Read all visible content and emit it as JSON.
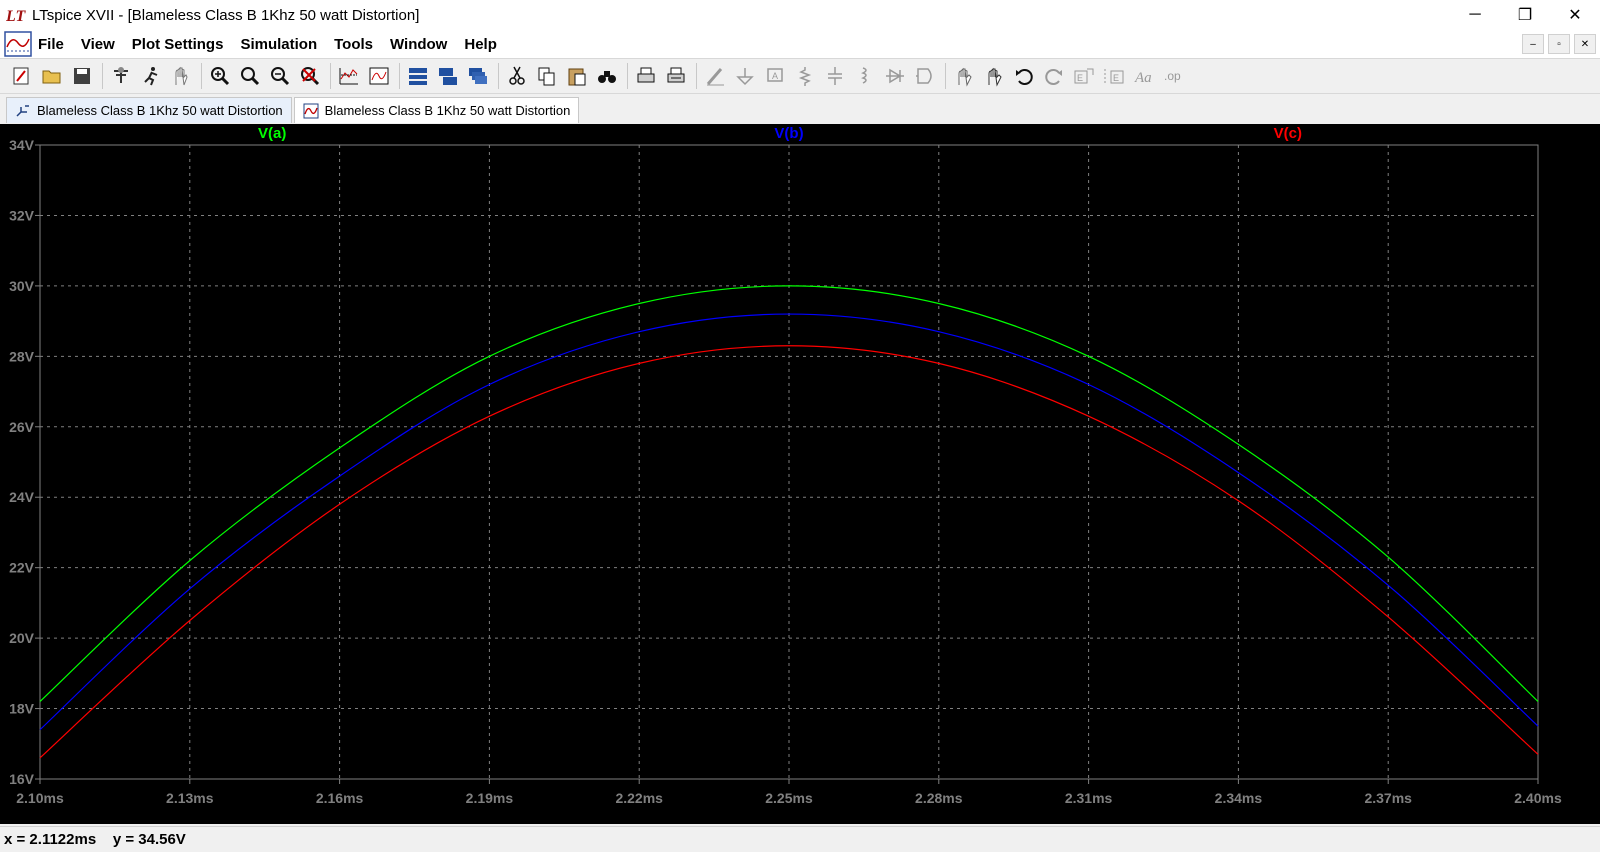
{
  "window": {
    "title": "LTspice XVII - [Blameless Class B 1Khz 50 watt Distortion]",
    "minimize_glyph": "─",
    "maximize_glyph": "❐",
    "close_glyph": "✕"
  },
  "menu": {
    "items": [
      "File",
      "View",
      "Plot Settings",
      "Simulation",
      "Tools",
      "Window",
      "Help"
    ],
    "mdi": [
      "–",
      "▫",
      "✕"
    ]
  },
  "toolbar": {
    "buttons": [
      "new-schematic-icon",
      "open-icon",
      "save-icon",
      "control-panel-icon",
      "run-icon",
      "halt-icon",
      "zoom-in-icon",
      "zoom-area-icon",
      "zoom-out-icon",
      "zoom-cancel-icon",
      "autorange-icon",
      "waveform-icon",
      "tile-horizontal-icon",
      "tile-vertical-icon",
      "cascade-icon",
      "cut-icon",
      "copy-icon",
      "paste-icon",
      "find-icon",
      "print-icon",
      "print-setup-icon",
      "draw-wire-icon",
      "ground-icon",
      "label-net-icon",
      "resistor-icon",
      "capacitor-icon",
      "inductor-icon",
      "diode-icon",
      "component-icon",
      "move-icon",
      "drag-icon",
      "undo-icon",
      "redo-icon",
      "rotate-icon",
      "mirror-icon",
      "text-icon",
      "spice-directive-icon"
    ]
  },
  "tabs": [
    {
      "label": "Blameless Class B 1Khz 50 watt Distortion",
      "icon": "schematic-icon"
    },
    {
      "label": "Blameless Class B 1Khz 50 watt Distortion",
      "icon": "waveform-icon"
    }
  ],
  "status": {
    "cursor_readout": "x = 2.1122ms    y = 34.56V"
  },
  "chart_data": {
    "type": "line",
    "title": "",
    "xlabel": "",
    "ylabel": "",
    "xlim": [
      2.1,
      2.4
    ],
    "ylim": [
      16,
      34
    ],
    "x_ticks": [
      "2.10ms",
      "2.13ms",
      "2.16ms",
      "2.19ms",
      "2.22ms",
      "2.25ms",
      "2.28ms",
      "2.31ms",
      "2.34ms",
      "2.37ms",
      "2.40ms"
    ],
    "y_ticks": [
      "16V",
      "18V",
      "20V",
      "22V",
      "24V",
      "26V",
      "28V",
      "30V",
      "32V",
      "34V"
    ],
    "grid": true,
    "background": "#000000",
    "series": [
      {
        "name": "V(a)",
        "color": "#00ff00",
        "x": [
          2.1,
          2.13,
          2.16,
          2.19,
          2.22,
          2.25,
          2.28,
          2.31,
          2.34,
          2.37,
          2.4
        ],
        "values": [
          18.2,
          22.2,
          25.4,
          28.0,
          29.5,
          30.0,
          29.5,
          28.0,
          25.5,
          22.3,
          18.2
        ]
      },
      {
        "name": "V(b)",
        "color": "#0000ff",
        "x": [
          2.1,
          2.13,
          2.16,
          2.19,
          2.22,
          2.25,
          2.28,
          2.31,
          2.34,
          2.37,
          2.4
        ],
        "values": [
          17.4,
          21.4,
          24.6,
          27.2,
          28.7,
          29.2,
          28.7,
          27.2,
          24.7,
          21.5,
          17.5
        ]
      },
      {
        "name": "V(c)",
        "color": "#ff0000",
        "x": [
          2.1,
          2.13,
          2.16,
          2.19,
          2.22,
          2.25,
          2.28,
          2.31,
          2.34,
          2.37,
          2.4
        ],
        "values": [
          16.6,
          20.5,
          23.8,
          26.3,
          27.8,
          28.3,
          27.8,
          26.3,
          23.9,
          20.6,
          16.7
        ]
      }
    ]
  }
}
